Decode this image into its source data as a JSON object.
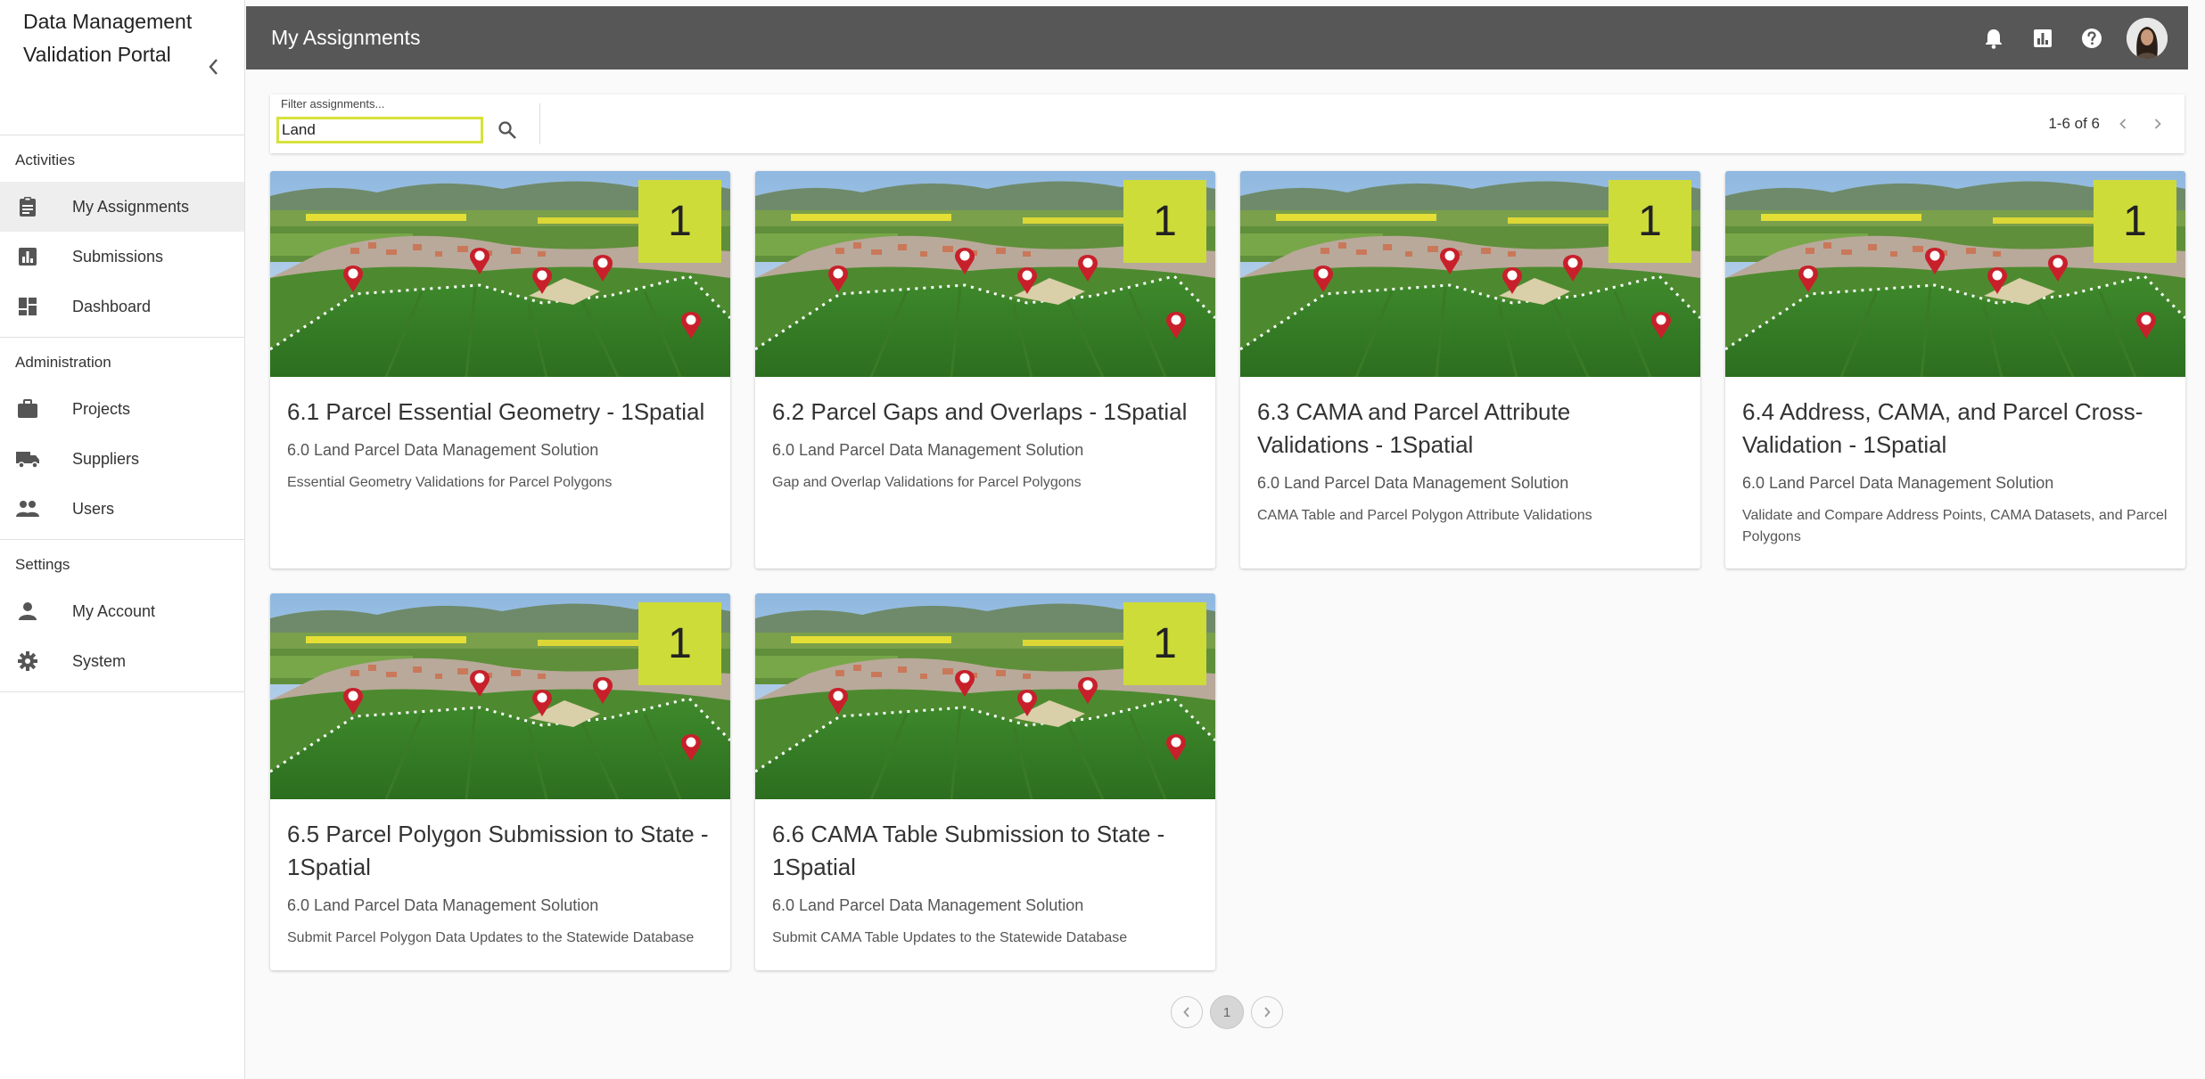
{
  "app": {
    "name": "Data Management Validation Portal"
  },
  "header": {
    "title": "My Assignments"
  },
  "sidebar": {
    "sections": [
      {
        "title": "Activities",
        "items": [
          {
            "label": "My Assignments",
            "icon": "clipboard-icon",
            "active": true
          },
          {
            "label": "Submissions",
            "icon": "bar-chart-icon"
          },
          {
            "label": "Dashboard",
            "icon": "dashboard-icon"
          }
        ]
      },
      {
        "title": "Administration",
        "items": [
          {
            "label": "Projects",
            "icon": "briefcase-icon"
          },
          {
            "label": "Suppliers",
            "icon": "truck-icon"
          },
          {
            "label": "Users",
            "icon": "users-icon"
          }
        ]
      },
      {
        "title": "Settings",
        "items": [
          {
            "label": "My Account",
            "icon": "person-icon"
          },
          {
            "label": "System",
            "icon": "gear-icon"
          }
        ]
      }
    ]
  },
  "filter": {
    "label": "Filter assignments...",
    "value": "Land"
  },
  "pagination": {
    "range": "1-6 of 6",
    "current_page": "1"
  },
  "cards": [
    {
      "badge": "1",
      "title": "6.1 Parcel Essential Geometry - 1Spatial",
      "subtitle": "6.0 Land Parcel Data Management Solution",
      "description": "Essential Geometry Validations for Parcel Polygons"
    },
    {
      "badge": "1",
      "title": "6.2 Parcel Gaps and Overlaps - 1Spatial",
      "subtitle": "6.0 Land Parcel Data Management Solution",
      "description": "Gap and Overlap Validations for Parcel Polygons"
    },
    {
      "badge": "1",
      "title": "6.3 CAMA and Parcel Attribute Validations - 1Spatial",
      "subtitle": "6.0 Land Parcel Data Management Solution",
      "description": "CAMA Table and Parcel Polygon Attribute Validations"
    },
    {
      "badge": "1",
      "title": "6.4 Address, CAMA, and Parcel Cross-Validation - 1Spatial",
      "subtitle": "6.0 Land Parcel Data Management Solution",
      "description": "Validate and Compare Address Points, CAMA Datasets, and Parcel Polygons"
    },
    {
      "badge": "1",
      "title": "6.5 Parcel Polygon Submission to State - 1Spatial",
      "subtitle": "6.0 Land Parcel Data Management Solution",
      "description": "Submit Parcel Polygon Data Updates to the Statewide Database"
    },
    {
      "badge": "1",
      "title": "6.6 CAMA Table Submission to State - 1Spatial",
      "subtitle": "6.0 Land Parcel Data Management Solution",
      "description": "Submit CAMA Table Updates to the Statewide Database"
    }
  ],
  "colors": {
    "accent": "#cddc39",
    "topbar": "#575757",
    "focus_border": "#d6e23a"
  }
}
